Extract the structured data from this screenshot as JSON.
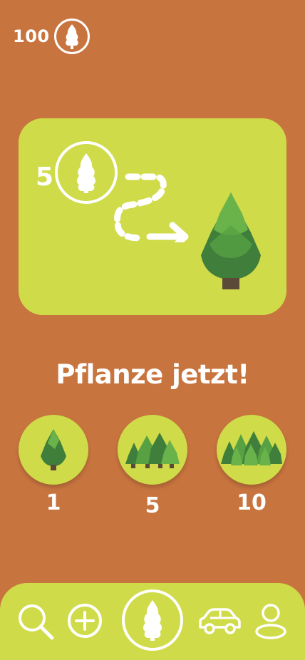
{
  "header": {
    "balance": "100",
    "currency_icon": "tree-coin-icon"
  },
  "info_card": {
    "cost": "5",
    "illustration": "coin-to-tree-icon"
  },
  "headline": "Pflanze jetzt!",
  "options": [
    {
      "label": "1",
      "icon": "single-tree-icon"
    },
    {
      "label": "5",
      "icon": "small-forest-icon"
    },
    {
      "label": "10",
      "icon": "large-forest-icon"
    }
  ],
  "nav": {
    "items": [
      "search-icon",
      "add-icon",
      "tree-icon",
      "car-icon",
      "profile-icon"
    ]
  },
  "colors": {
    "background": "#c8743f",
    "accent": "#cfdb48",
    "tree_light": "#6ab34a",
    "tree_dark": "#3f7e3b"
  }
}
